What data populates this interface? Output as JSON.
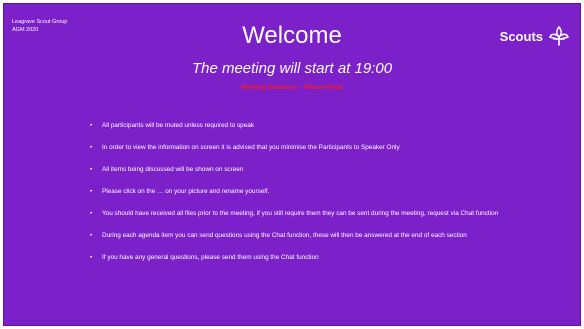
{
  "slide": {
    "org_line1": "Leagrave Scout Group",
    "org_line2": "AGM 2020",
    "title": "Welcome",
    "logo_text": "Scouts",
    "logo_icon": "fleur-de-lis-icon",
    "subtitle": "The meeting will start at 19:00",
    "notice": "Meeting Guidance – Please Read",
    "bullet_char": "•",
    "bullets": [
      "All participants will be muted unless required to speak",
      "In order to view the information on screen it is advised that you minimise the Participants  to Speaker Only",
      "All items being discussed will be shown on screen",
      "Please click on the … on your picture and rename yourself.",
      "You should have received all files prior to the meeting, if you still require them they can be sent during the meeting, request via Chat function",
      "During each agenda item you can send questions using the Chat function, these will then be answered at the end of each section",
      "If you have any general questions, please send them using the Chat function"
    ]
  },
  "colors": {
    "background": "#7c20c9",
    "text": "#ffffff",
    "notice": "#ff1a1a"
  }
}
